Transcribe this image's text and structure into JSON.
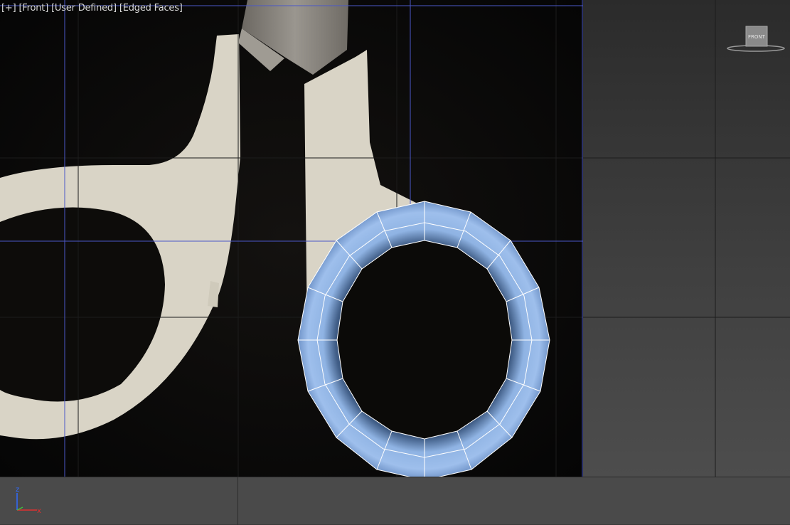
{
  "viewport": {
    "label_plus": "[+]",
    "label_view": "[Front]",
    "label_shading_mode": "[User Defined]",
    "label_display": "[Edged Faces]"
  },
  "viewcube": {
    "face_label": "FRONT",
    "icon": "viewcube-icon"
  },
  "axis_tripod": {
    "z_label": "z",
    "x_label": "x",
    "z_color": "#2f6bff",
    "x_color": "#e03030",
    "icon": "axis-tripod-icon"
  },
  "reference_image": {
    "subject": "scissors handles",
    "icon": "reference-photo"
  },
  "model": {
    "shape": "torus",
    "color": "#8fb3e3",
    "edge_color": "#ffffff"
  },
  "colors": {
    "grid_major": "#4b58c8",
    "grid_minor": "#1a1a1a",
    "viewport_bg_top": "#2b2b2b",
    "viewport_bg_bottom": "#4d4d4d",
    "photo_bg": "#0c0b09",
    "handle_color": "#d9d4c6",
    "blade_color": "#8a8680"
  }
}
